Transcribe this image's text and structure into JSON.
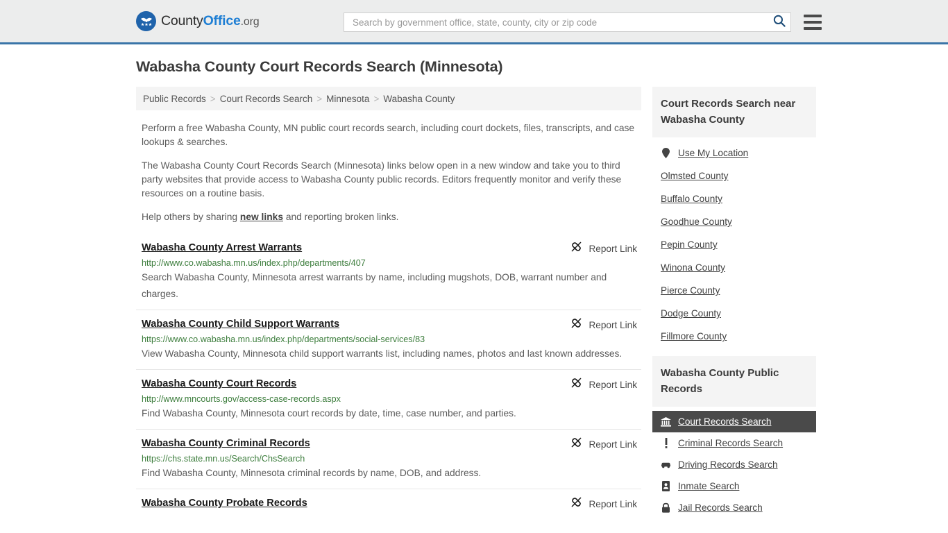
{
  "header": {
    "logo": {
      "icon": "eagle-shield-icon",
      "text_1": "County",
      "text_2": "Office",
      "text_3": ".org"
    },
    "search": {
      "placeholder": "Search by government office, state, county, city or zip code",
      "value": "",
      "search_icon": "search-icon"
    },
    "menu_icon": "hamburger-menu-icon",
    "accent_color": "#3a75a8",
    "background_color": "#eceded"
  },
  "page": {
    "title": "Wabasha County Court Records Search (Minnesota)"
  },
  "breadcrumb": {
    "items": [
      {
        "label": "Public Records"
      },
      {
        "label": "Court Records Search"
      },
      {
        "label": "Minnesota"
      },
      {
        "label": "Wabasha County"
      }
    ],
    "separator": ">"
  },
  "intro": {
    "paragraph_1": "Perform a free Wabasha County, MN public court records search, including court dockets, files, transcripts, and case lookups & searches.",
    "paragraph_2": "The Wabasha County Court Records Search (Minnesota) links below open in a new window and take you to third party websites that provide access to Wabasha County public records. Editors frequently monitor and verify these resources on a routine basis.",
    "paragraph_3_pre": "Help others by sharing ",
    "paragraph_3_link": "new links",
    "paragraph_3_post": " and reporting broken links."
  },
  "report_link": {
    "label": "Report Link",
    "icon": "broken-link-icon"
  },
  "results": [
    {
      "title": "Wabasha County Arrest Warrants",
      "url": "http://www.co.wabasha.mn.us/index.php/departments/407",
      "description": "Search Wabasha County, Minnesota arrest warrants by name, including mugshots, DOB, warrant number and charges."
    },
    {
      "title": "Wabasha County Child Support Warrants",
      "url": "https://www.co.wabasha.mn.us/index.php/departments/social-services/83",
      "description": "View Wabasha County, Minnesota child support warrants list, including names, photos and last known addresses."
    },
    {
      "title": "Wabasha County Court Records",
      "url": "http://www.mncourts.gov/access-case-records.aspx",
      "description": "Find Wabasha County, Minnesota court records by date, time, case number, and parties."
    },
    {
      "title": "Wabasha County Criminal Records",
      "url": "https://chs.state.mn.us/Search/ChsSearch",
      "description": "Find Wabasha County, Minnesota criminal records by name, DOB, and address."
    },
    {
      "title": "Wabasha County Probate Records",
      "url": "",
      "description": ""
    }
  ],
  "sidebar": {
    "nearby": {
      "heading": "Court Records Search near Wabasha County",
      "items": [
        {
          "label": "Use My Location",
          "icon": "map-pin-icon"
        },
        {
          "label": "Olmsted County",
          "icon": ""
        },
        {
          "label": "Buffalo County",
          "icon": ""
        },
        {
          "label": "Goodhue County",
          "icon": ""
        },
        {
          "label": "Pepin County",
          "icon": ""
        },
        {
          "label": "Winona County",
          "icon": ""
        },
        {
          "label": "Pierce County",
          "icon": ""
        },
        {
          "label": "Dodge County",
          "icon": ""
        },
        {
          "label": "Fillmore County",
          "icon": ""
        }
      ]
    },
    "public_records": {
      "heading": "Wabasha County Public Records",
      "active_background": "#4a4a4a",
      "items": [
        {
          "label": "Court Records Search",
          "icon": "courthouse-icon",
          "active": true
        },
        {
          "label": "Criminal Records Search",
          "icon": "exclamation-icon",
          "active": false
        },
        {
          "label": "Driving Records Search",
          "icon": "car-icon",
          "active": false
        },
        {
          "label": "Inmate Search",
          "icon": "id-badge-icon",
          "active": false
        },
        {
          "label": "Jail Records Search",
          "icon": "lock-icon",
          "active": false
        }
      ]
    }
  }
}
